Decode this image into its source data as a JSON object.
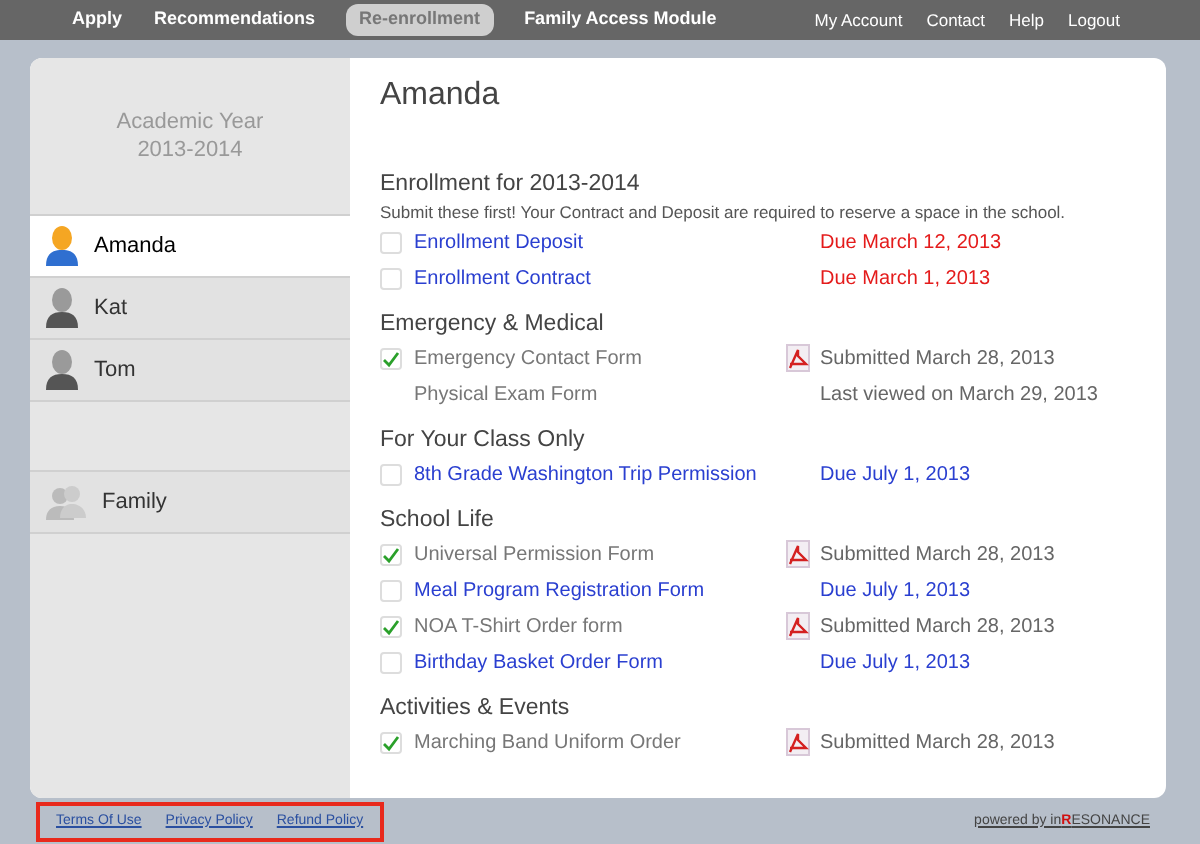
{
  "nav": {
    "left": [
      {
        "label": "Apply",
        "selected": false
      },
      {
        "label": "Recommendations",
        "selected": false
      },
      {
        "label": "Re-enrollment",
        "selected": true
      },
      {
        "label": "Family Access Module",
        "selected": false
      }
    ],
    "right": [
      "My Account",
      "Contact",
      "Help",
      "Logout"
    ]
  },
  "sidebar": {
    "header": [
      "Academic Year",
      "2013-2014"
    ],
    "items": [
      {
        "label": "Amanda",
        "kind": "person",
        "selected": true
      },
      {
        "label": "Kat",
        "kind": "person",
        "selected": false
      },
      {
        "label": "Tom",
        "kind": "person",
        "selected": false
      },
      {
        "label": "Family",
        "kind": "group",
        "selected": false
      }
    ]
  },
  "content": {
    "title": "Amanda",
    "sections": [
      {
        "heading": "Enrollment for 2013-2014",
        "note": "Submit these first! Your Contract and Deposit are required to reserve a space in the school.",
        "items": [
          {
            "kind": "task",
            "label": "Enrollment Deposit",
            "checked": false,
            "pdf": false,
            "urgent": true,
            "status": "Due March 12, 2013"
          },
          {
            "kind": "task",
            "label": "Enrollment Contract",
            "checked": false,
            "pdf": false,
            "urgent": true,
            "status": "Due March 1, 2013"
          }
        ]
      },
      {
        "heading": "Emergency & Medical",
        "items": [
          {
            "kind": "task",
            "label": "Emergency Contact Form",
            "checked": true,
            "pdf": true,
            "urgent": false,
            "status": "Submitted March 28, 2013"
          },
          {
            "kind": "info",
            "label": "Physical Exam Form",
            "pdf": false,
            "urgent": false,
            "status": "Last viewed on March 29, 2013"
          }
        ]
      },
      {
        "heading": "For Your Class Only",
        "items": [
          {
            "kind": "task",
            "label": "8th Grade Washington Trip Permission",
            "checked": false,
            "pdf": false,
            "urgent": false,
            "status": "Due July 1, 2013"
          }
        ]
      },
      {
        "heading": "School Life",
        "items": [
          {
            "kind": "task",
            "label": "Universal Permission Form",
            "checked": true,
            "pdf": true,
            "urgent": false,
            "status": "Submitted March 28, 2013"
          },
          {
            "kind": "task",
            "label": "Meal Program Registration Form",
            "checked": false,
            "pdf": false,
            "urgent": false,
            "status": "Due July 1, 2013"
          },
          {
            "kind": "task",
            "label": "NOA T-Shirt Order form",
            "checked": true,
            "pdf": true,
            "urgent": false,
            "status": "Submitted March 28, 2013"
          },
          {
            "kind": "task",
            "label": "Birthday Basket Order Form",
            "checked": false,
            "pdf": false,
            "urgent": false,
            "status": "Due July 1, 2013"
          }
        ]
      },
      {
        "heading": "Activities & Events",
        "items": [
          {
            "kind": "task",
            "label": "Marching Band Uniform Order",
            "checked": true,
            "pdf": true,
            "urgent": false,
            "status": "Submitted March 28, 2013"
          }
        ]
      }
    ]
  },
  "footer": {
    "links": [
      "Terms Of Use",
      "Privacy Policy",
      "Refund Policy"
    ],
    "credit": [
      {
        "text": "powered by in",
        "accent": false
      },
      {
        "text": "R",
        "accent": true
      },
      {
        "text": "ESONANCE",
        "accent": false
      }
    ]
  }
}
